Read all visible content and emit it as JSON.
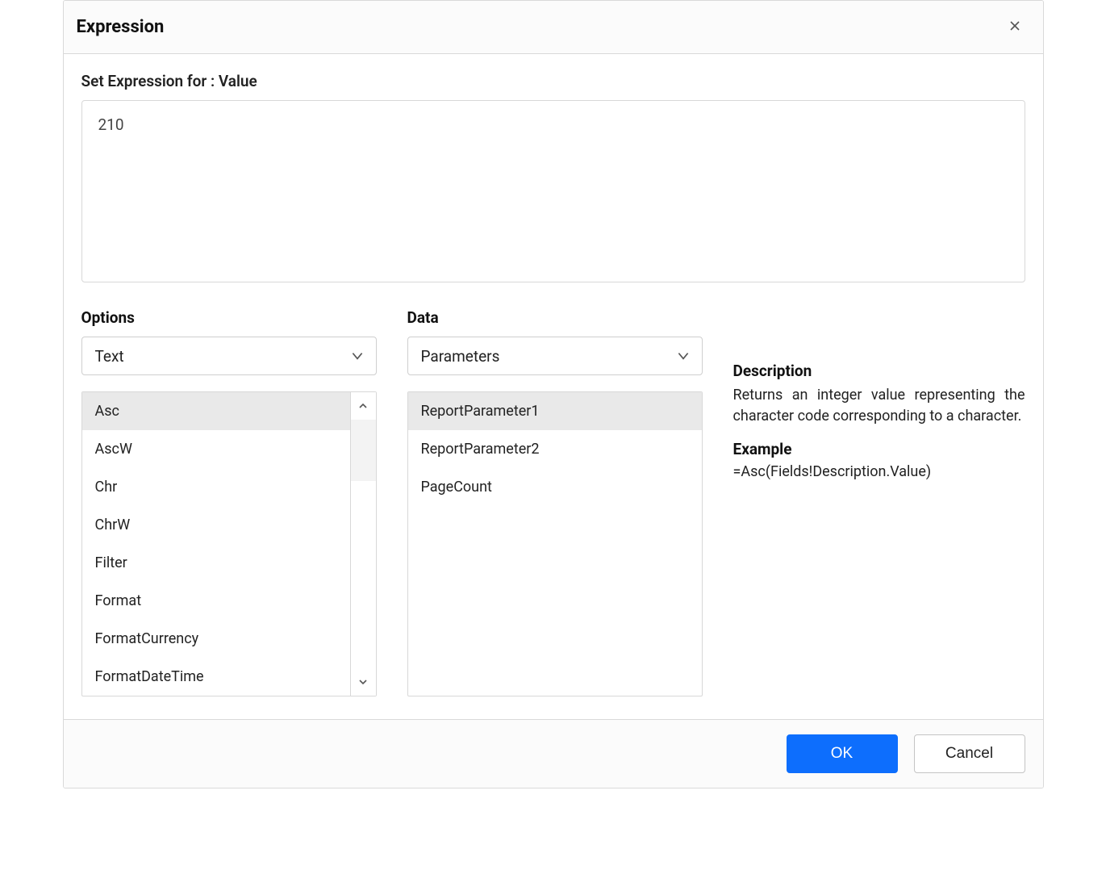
{
  "dialog": {
    "title": "Expression",
    "set_expression_label": "Set Expression for : Value",
    "expression_value": "210"
  },
  "options": {
    "heading": "Options",
    "dropdown_value": "Text",
    "items": [
      "Asc",
      "AscW",
      "Chr",
      "ChrW",
      "Filter",
      "Format",
      "FormatCurrency",
      "FormatDateTime"
    ],
    "item0": "Asc",
    "item1": "AscW",
    "item2": "Chr",
    "item3": "ChrW",
    "item4": "Filter",
    "item5": "Format",
    "item6": "FormatCurrency",
    "item7": "FormatDateTime"
  },
  "data": {
    "heading": "Data",
    "dropdown_value": "Parameters",
    "items": [
      "ReportParameter1",
      "ReportParameter2",
      "PageCount"
    ],
    "item0": "ReportParameter1",
    "item1": "ReportParameter2",
    "item2": "PageCount"
  },
  "description": {
    "heading": "Description",
    "text": "Returns an integer value representing the character code corresponding to a character.",
    "example_heading": "Example",
    "example_text": "=Asc(Fields!Description.Value)"
  },
  "footer": {
    "ok_label": "OK",
    "cancel_label": "Cancel"
  }
}
